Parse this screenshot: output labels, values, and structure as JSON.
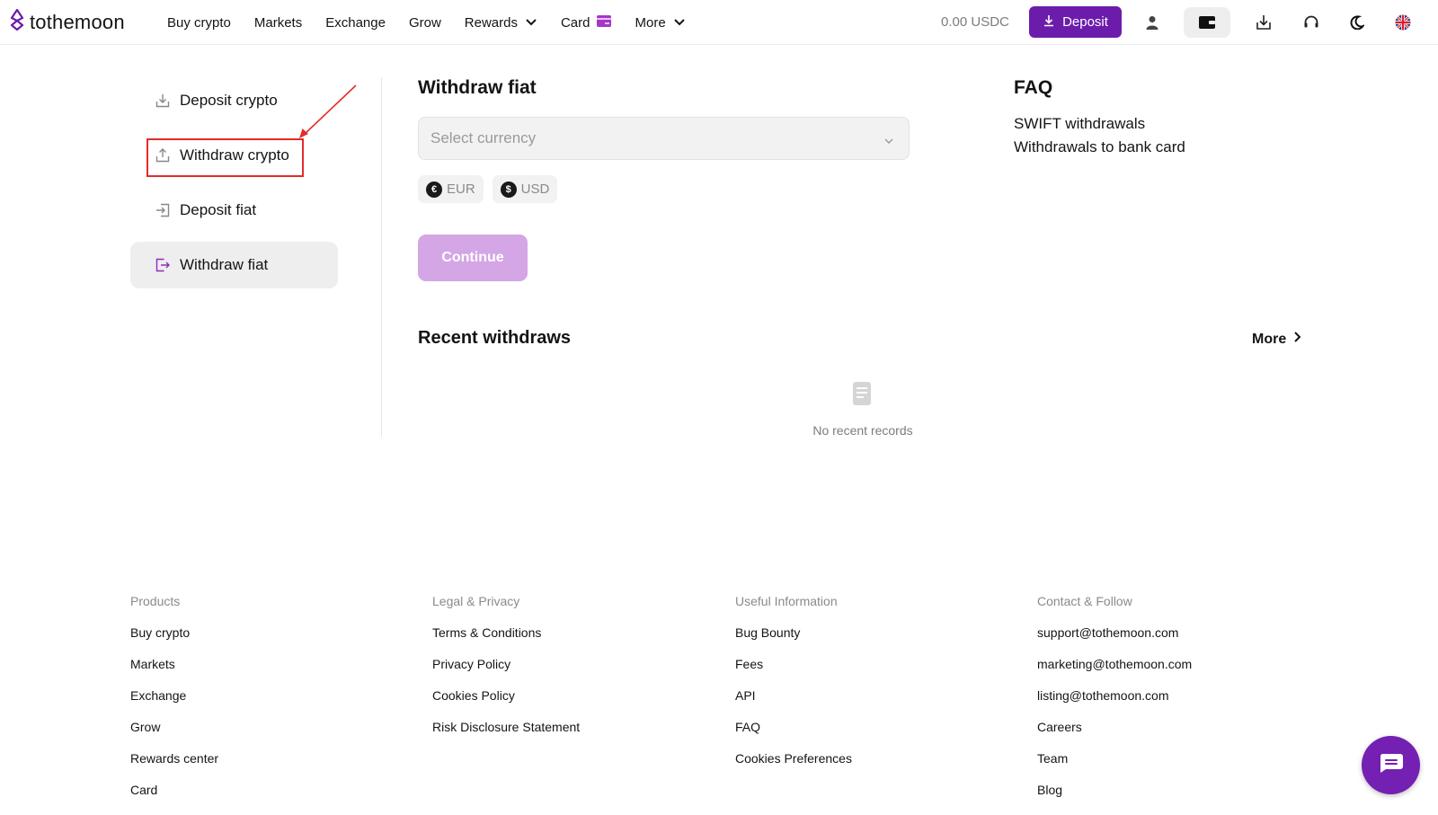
{
  "brand": {
    "name": "tothemoon",
    "accent": "#6c1cab"
  },
  "nav": {
    "items": [
      "Buy crypto",
      "Markets",
      "Exchange",
      "Grow",
      "Rewards",
      "Card",
      "More"
    ]
  },
  "header": {
    "balance": "0.00 USDC",
    "deposit_label": "Deposit",
    "icons": [
      "user-icon",
      "wallet-icon",
      "download-app-icon",
      "support-headset-icon",
      "dark-mode-icon",
      "language-flag-icon"
    ]
  },
  "sidebar": {
    "items": [
      {
        "label": "Deposit crypto",
        "icon": "download-icon",
        "active": false
      },
      {
        "label": "Withdraw crypto",
        "icon": "upload-icon",
        "active": false
      },
      {
        "label": "Deposit fiat",
        "icon": "sign-in-icon",
        "active": false
      },
      {
        "label": "Withdraw fiat",
        "icon": "sign-out-icon",
        "active": true
      }
    ]
  },
  "main": {
    "title": "Withdraw fiat",
    "currency_placeholder": "Select currency",
    "chips": [
      {
        "symbol": "€",
        "label": "EUR"
      },
      {
        "symbol": "$",
        "label": "USD"
      }
    ],
    "continue_label": "Continue",
    "recent_title": "Recent withdraws",
    "more_label": "More",
    "empty_text": "No recent records"
  },
  "faq": {
    "title": "FAQ",
    "links": [
      "SWIFT withdrawals",
      "Withdrawals to bank card"
    ]
  },
  "footer": {
    "columns": [
      {
        "heading": "Products",
        "links": [
          "Buy crypto",
          "Markets",
          "Exchange",
          "Grow",
          "Rewards center",
          "Card"
        ]
      },
      {
        "heading": "Legal & Privacy",
        "links": [
          "Terms & Conditions",
          "Privacy Policy",
          "Cookies Policy",
          "Risk Disclosure Statement"
        ]
      },
      {
        "heading": "Useful Information",
        "links": [
          "Bug Bounty",
          "Fees",
          "API",
          "FAQ",
          "Cookies Preferences"
        ]
      },
      {
        "heading": "Contact & Follow",
        "links": [
          "support@tothemoon.com",
          "marketing@tothemoon.com",
          "listing@tothemoon.com",
          "Careers",
          "Team",
          "Blog"
        ]
      }
    ]
  },
  "annotation": {
    "color": "#e32b2b"
  }
}
